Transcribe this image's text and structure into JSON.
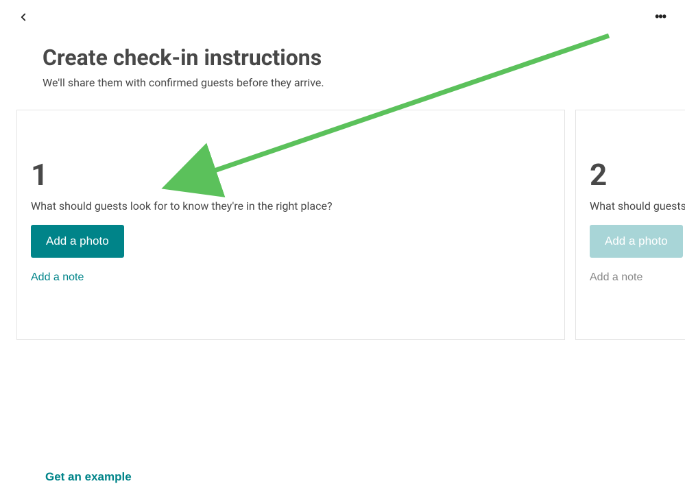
{
  "header": {
    "title": "Create check-in instructions",
    "subtitle": "We'll share them with confirmed guests before they arrive."
  },
  "steps": [
    {
      "number": "1",
      "prompt": "What should guests look for to know they're in the right place?",
      "add_photo_label": "Add a photo",
      "add_note_label": "Add a note",
      "active": true
    },
    {
      "number": "2",
      "prompt": "What should guests",
      "add_photo_label": "Add a photo",
      "add_note_label": "Add a note",
      "active": false
    }
  ],
  "footer": {
    "example_link": "Get an example"
  },
  "icons": {
    "back": "chevron-left-icon",
    "more": "more-horizontal-icon"
  },
  "colors": {
    "accent": "#008489",
    "accent_disabled": "#a8d5d7",
    "text": "#484848",
    "border": "#e4e4e4",
    "annotation": "#5bc15b"
  }
}
